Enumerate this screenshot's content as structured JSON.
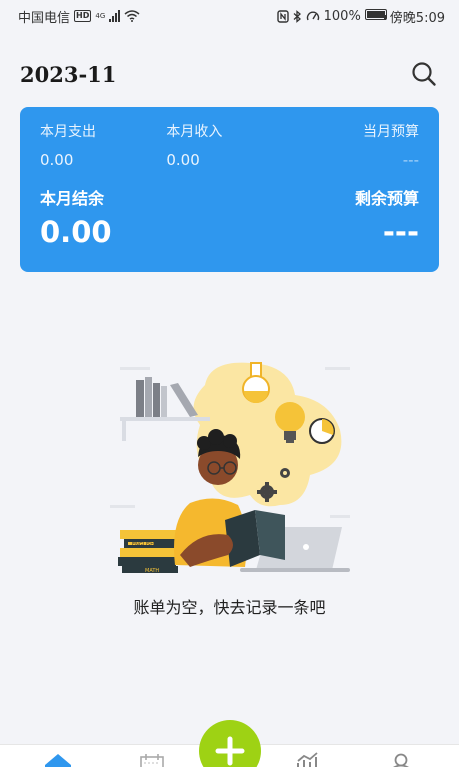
{
  "status_bar": {
    "carrier": "中国电信",
    "hd_badge": "HD",
    "network": "4G",
    "battery_percent": "100%",
    "time": "傍晚5:09"
  },
  "header": {
    "month": "2023-11",
    "search_icon": "search-icon"
  },
  "summary": {
    "expense_label": "本月支出",
    "expense_value": "0.00",
    "income_label": "本月收入",
    "income_value": "0.00",
    "budget_label": "当月预算",
    "budget_value": "---",
    "balance_label": "本月结余",
    "balance_value": "0.00",
    "remaining_budget_label": "剩余预算",
    "remaining_budget_value": "---",
    "card_color": "#2f97ee"
  },
  "empty_state": {
    "message": "账单为空，快去记录一条吧",
    "illustration": "reading-person-illustration",
    "book_labels": [
      "ENGLISH",
      "MATH"
    ]
  },
  "bottom_nav": {
    "items": [
      {
        "icon": "home-icon",
        "active": true
      },
      {
        "icon": "calendar-icon",
        "active": false
      },
      {
        "icon": "chart-icon",
        "active": false
      },
      {
        "icon": "user-icon",
        "active": false
      }
    ],
    "add_icon": "plus-icon",
    "fab_color": "#9ed214",
    "accent": "#2f97ee"
  }
}
